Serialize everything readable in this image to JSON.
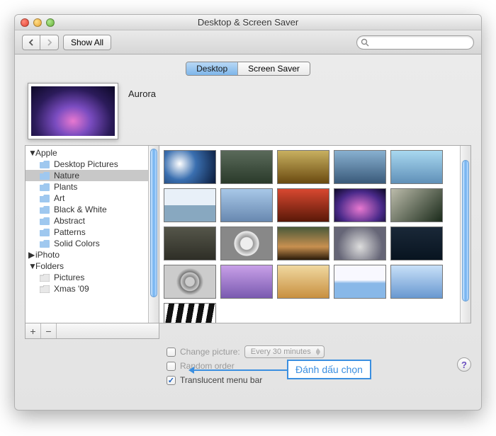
{
  "window": {
    "title": "Desktop & Screen Saver"
  },
  "toolbar": {
    "show_all_label": "Show All",
    "search_placeholder": ""
  },
  "tabs": {
    "desktop": "Desktop",
    "screensaver": "Screen Saver"
  },
  "preview": {
    "name": "Aurora"
  },
  "sidebar": {
    "apple": "Apple",
    "items": [
      "Desktop Pictures",
      "Nature",
      "Plants",
      "Art",
      "Black & White",
      "Abstract",
      "Patterns",
      "Solid Colors"
    ],
    "iphoto": "iPhoto",
    "folders": "Folders",
    "folder_items": [
      "Pictures",
      "Xmas '09"
    ]
  },
  "options": {
    "change_picture_label": "Change picture:",
    "interval": "Every 30 minutes",
    "random_label": "Random order",
    "translucent_label": "Translucent menu bar"
  },
  "annotation": {
    "text": "Đánh dấu chọn"
  },
  "footer": {
    "plus": "+",
    "minus": "−"
  }
}
